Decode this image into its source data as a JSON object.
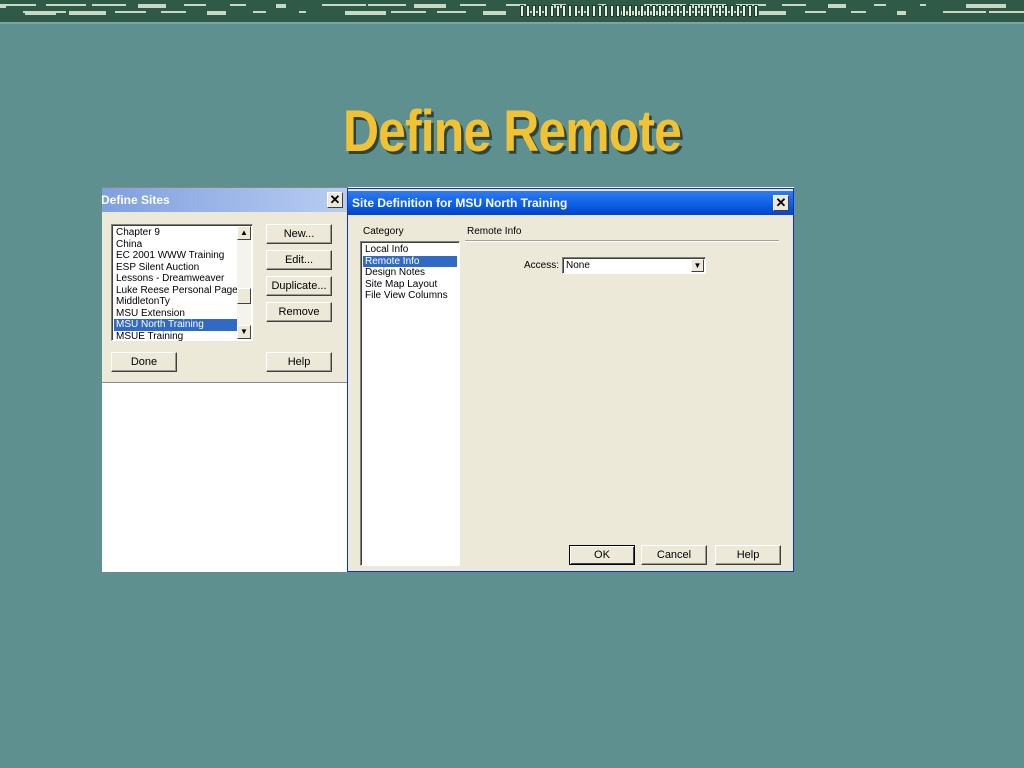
{
  "slide": {
    "title": "Define Remote"
  },
  "define_sites": {
    "title": "Define Sites",
    "sites": [
      "Chapter 9",
      "China",
      "EC 2001 WWW Training",
      "ESP Silent Auction",
      "Lessons - Dreamweaver",
      "Luke Reese Personal Pages",
      "MiddletonTy",
      "MSU Extension",
      "MSU North Training",
      "MSUE Training"
    ],
    "selected_site": "MSU North Training",
    "buttons": {
      "new": "New...",
      "edit": "Edit...",
      "duplicate": "Duplicate...",
      "remove": "Remove",
      "done": "Done",
      "help": "Help"
    }
  },
  "site_definition": {
    "title": "Site Definition for MSU North Training",
    "category_label": "Category",
    "categories": [
      "Local Info",
      "Remote Info",
      "Design Notes",
      "Site Map Layout",
      "File View Columns"
    ],
    "selected_category": "Remote Info",
    "section_title": "Remote Info",
    "access_label": "Access:",
    "access_value": "None",
    "buttons": {
      "ok": "OK",
      "cancel": "Cancel",
      "help": "Help"
    }
  },
  "colors": {
    "slide_background": "#5f9090",
    "title_color": "#f2c233",
    "active_titlebar": "#0a5ee0",
    "inactive_titlebar": "#7f9fde",
    "selection": "#316ac5",
    "dialog_face": "#ece9d8"
  }
}
